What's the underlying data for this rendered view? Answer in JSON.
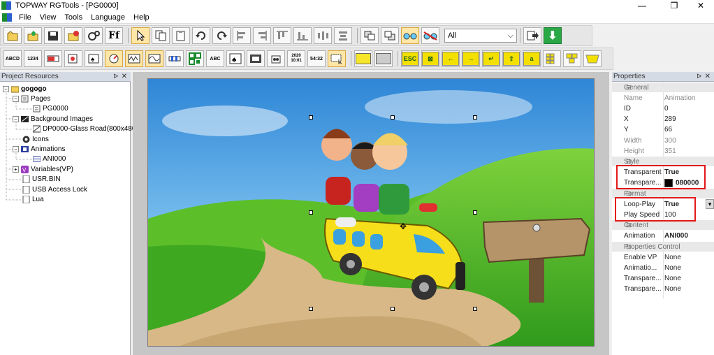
{
  "window": {
    "title": "TOPWAY RGTools - [PG0000]",
    "minimize": "—",
    "restore": "❐",
    "close": "✕"
  },
  "menu": [
    "File",
    "View",
    "Tools",
    "Language",
    "Help"
  ],
  "toolbar1": {
    "filter_value": "All",
    "filter_arrow": "⌵",
    "font_button": "Ff",
    "download_button": "⬇"
  },
  "toolbar2": {
    "abcd": "ABCD",
    "num": "1234",
    "abc": "ABC",
    "date": "2020 10:01",
    "time": "54:32",
    "esc": "ESC",
    "letter_a": "a"
  },
  "project": {
    "header": "Project Resources",
    "pin": "ᐅ",
    "close": "✕",
    "tree": {
      "root": "gogogo",
      "pages": "Pages",
      "page0": "PG0000",
      "bg": "Background Images",
      "bg0": "DP0000-Glass Road(800x480)",
      "icons": "Icons",
      "anims": "Animations",
      "anim0": "ANI000",
      "vars": "Variables(VP)",
      "usr": "USR.BIN",
      "usb": "USB Access Lock",
      "lua": "Lua"
    }
  },
  "properties": {
    "header": "Properties",
    "pin": "ᐅ",
    "close": "✕",
    "cats": {
      "general": "General",
      "style": "Style",
      "format": "Format",
      "content": "Content",
      "control": "Properties Control"
    },
    "general": [
      {
        "k": "Name",
        "v": "Animation"
      },
      {
        "k": "ID",
        "v": "0"
      },
      {
        "k": "X",
        "v": "289"
      },
      {
        "k": "Y",
        "v": "66"
      },
      {
        "k": "Width",
        "v": "300"
      },
      {
        "k": "Height",
        "v": "351"
      }
    ],
    "style": [
      {
        "k": "Transparent",
        "v": "True"
      },
      {
        "k": "Transpare...",
        "v": "080000"
      }
    ],
    "format": [
      {
        "k": "Loop-Play",
        "v": "True"
      },
      {
        "k": "Play Speed",
        "v": "100"
      }
    ],
    "content": [
      {
        "k": "Animation",
        "v": "ANI000"
      }
    ],
    "control": [
      {
        "k": "Enable VP",
        "v": "None"
      },
      {
        "k": "Animatio...",
        "v": "None"
      },
      {
        "k": "Transpare...",
        "v": "None"
      },
      {
        "k": "Transpare...",
        "v": "None"
      }
    ],
    "dropdown_arrow": "▾",
    "collapse_glyph": "⊟"
  },
  "colors": {
    "accent_red": "#e31818",
    "transparent_color": "#080000",
    "panel_head": "#d4dbe4"
  }
}
